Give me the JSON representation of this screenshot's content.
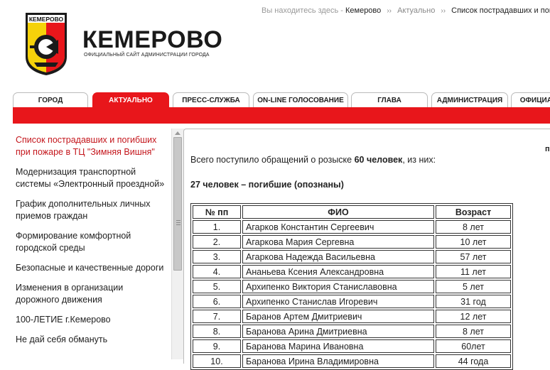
{
  "header": {
    "shield_text": "КЕМЕРОВО",
    "title": "КЕМЕРОВО",
    "subtitle": "ОФИЦИАЛЬНЫЙ САЙТ АДМИНИСТРАЦИИ ГОРОДА"
  },
  "breadcrumb": {
    "prefix": "Вы находитесь здесь -",
    "items": [
      "Кемерово",
      "Актуально",
      "Список пострадавших и погибших"
    ]
  },
  "nav": {
    "tabs": [
      "ГОРОД",
      "АКТУАЛЬНО",
      "ПРЕСС-СЛУЖБА",
      "ON-LINE ГОЛОСОВАНИЕ",
      "ГЛАВА",
      "АДМИНИСТРАЦИЯ",
      "ОФИЦИАЛЬНО"
    ],
    "active_index": 1
  },
  "sidebar": {
    "items": [
      "Список пострадавших и погибших при пожаре в ТЦ \"Зимняя Вишня\"",
      "Модернизация транспортной системы «Электронный проездной»",
      "График дополнительных личных приемов граждан",
      "Формирование комфортной городской среды",
      "Безопасные и качественные дороги",
      "Изменения в организации дорожного движения",
      "100-ЛЕТИЕ г.Кемерово",
      "Не дай себя обмануть"
    ]
  },
  "content": {
    "corner_letter": "п",
    "intro_before": "Всего поступило обращений о розыске ",
    "intro_bold": "60 человек",
    "intro_after": ", из них:",
    "subhead": "27 человек – погибшие (опознаны)",
    "table": {
      "headers": [
        "№ пп",
        "ФИО",
        "Возраст"
      ],
      "rows": [
        [
          "1.",
          "Агарков Константин Сергеевич",
          "8 лет"
        ],
        [
          "2.",
          "Агаркова Мария Сергевна",
          "10 лет"
        ],
        [
          "3.",
          "Агаркова Надежда Васильевна",
          "57 лет"
        ],
        [
          "4.",
          "Ананьева Ксения Александровна",
          "11 лет"
        ],
        [
          "5.",
          "Архипенко Виктория Станиславовна",
          "5 лет"
        ],
        [
          "6.",
          "Архипенко Станислав Игоревич",
          "31 год"
        ],
        [
          "7.",
          "Баранов Артем Дмитриевич",
          "12 лет"
        ],
        [
          "8.",
          "Баранова Арина Дмитриевна",
          "8 лет"
        ],
        [
          "9.",
          "Баранова Марина Ивановна",
          "60лет"
        ],
        [
          "10.",
          "Баранова Ирина Владимировна",
          "44 года"
        ]
      ]
    }
  },
  "colors": {
    "brand_red": "#e8161b",
    "shield_yellow": "#f5d20a",
    "text": "#222222"
  },
  "icons": {
    "logo": "kemerovo-coat-of-arms-icon",
    "scroll_up": "scroll-up-arrow-icon"
  }
}
